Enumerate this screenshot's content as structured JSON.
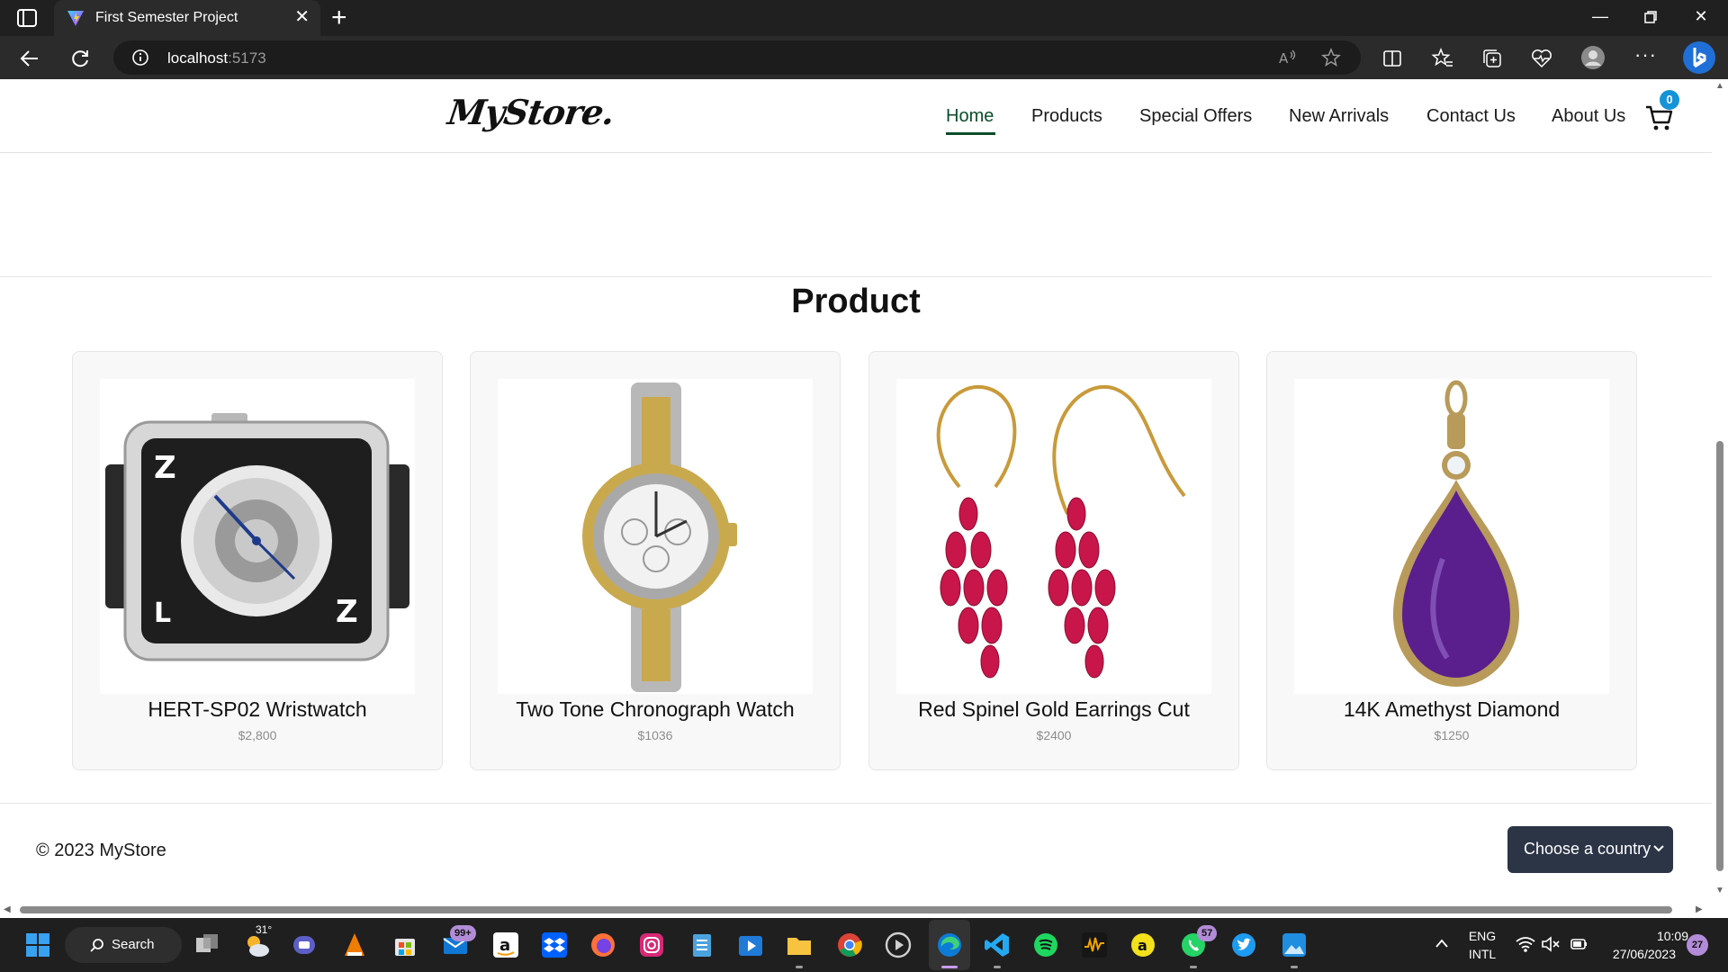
{
  "browser": {
    "tab_title": "First Semester Project",
    "address_host": "localhost",
    "address_port": ":5173"
  },
  "navbar": {
    "logo": "MyStore.",
    "links": [
      "Home",
      "Products",
      "Special Offers",
      "New Arrivals",
      "Contact Us",
      "About Us"
    ],
    "active_link": "Home",
    "cart_count": "0"
  },
  "products": {
    "title": "Product",
    "items": [
      {
        "name": "HERT-SP02 Wristwatch",
        "price": "$2,800"
      },
      {
        "name": "Two Tone Chronograph Watch",
        "price": "$1036"
      },
      {
        "name": "Red Spinel Gold Earrings Cut",
        "price": "$2400"
      },
      {
        "name": "14K Amethyst Diamond",
        "price": "$1250"
      }
    ]
  },
  "footer": {
    "copyright": "© 2023 MyStore",
    "country_select": "Choose a country"
  },
  "taskbar": {
    "search_label": "Search",
    "weather": "31°",
    "mail_badge": "99+",
    "whatsapp_badge": "57",
    "language": "ENG",
    "keyboard": "INTL",
    "time": "10:09",
    "date": "27/06/2023",
    "notifications": "27"
  },
  "colors": {
    "nav_active": "#0b4d2a",
    "cart_badge": "#1493d8",
    "select_bg": "#2c3546"
  }
}
